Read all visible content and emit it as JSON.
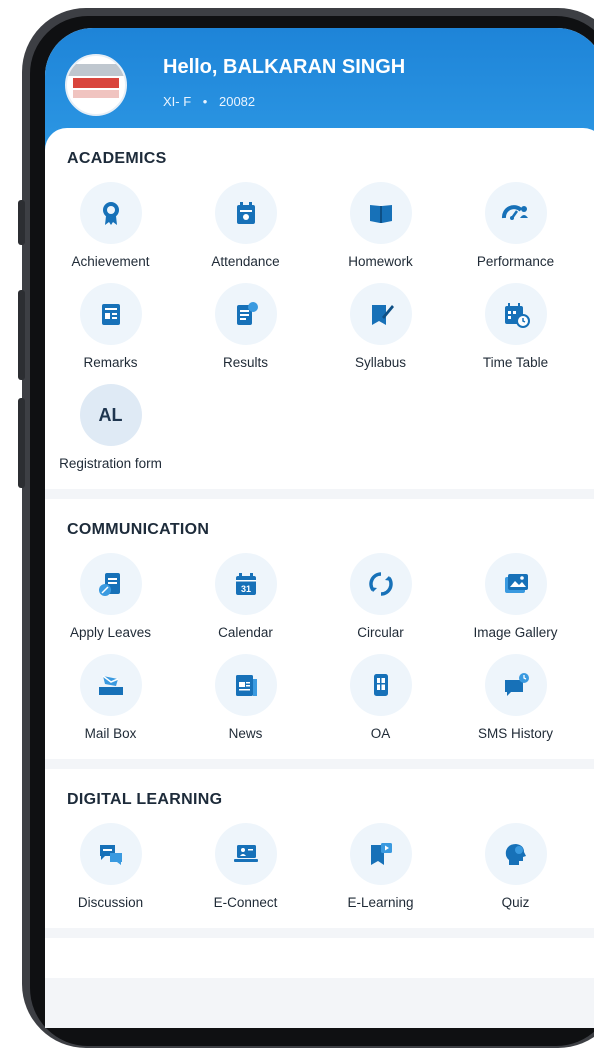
{
  "header": {
    "greeting": "Hello, BALKARAN SINGH",
    "class_section": "XI- F",
    "separator": "•",
    "admission_no": "20082"
  },
  "colors": {
    "header_blue": "#1e84d8",
    "icon_blue": "#1771b8",
    "icon_bg": "#eef5fb"
  },
  "academics": {
    "title": "ACADEMICS",
    "items": [
      {
        "label": "Achievement",
        "icon": "award-icon"
      },
      {
        "label": "Attendance",
        "icon": "attendance-icon"
      },
      {
        "label": "Homework",
        "icon": "book-icon"
      },
      {
        "label": "Performance",
        "icon": "performance-icon"
      },
      {
        "label": "Remarks",
        "icon": "remarks-icon"
      },
      {
        "label": "Results",
        "icon": "results-icon"
      },
      {
        "label": "Syllabus",
        "icon": "syllabus-icon"
      },
      {
        "label": "Time Table",
        "icon": "timetable-icon"
      },
      {
        "label": "Registration form",
        "initials": "AL"
      }
    ]
  },
  "communication": {
    "title": "COMMUNICATION",
    "items": [
      {
        "label": "Apply Leaves",
        "icon": "apply-leave-icon"
      },
      {
        "label": "Calendar",
        "icon": "calendar-icon",
        "day": "31"
      },
      {
        "label": "Circular",
        "icon": "circular-icon"
      },
      {
        "label": "Image Gallery",
        "icon": "image-gallery-icon"
      },
      {
        "label": "Mail Box",
        "icon": "mailbox-icon"
      },
      {
        "label": "News",
        "icon": "news-icon"
      },
      {
        "label": "OA",
        "icon": "oa-icon"
      },
      {
        "label": "SMS History",
        "icon": "sms-history-icon"
      }
    ]
  },
  "digital_learning": {
    "title": "DIGITAL LEARNING",
    "items": [
      {
        "label": "Discussion",
        "icon": "discussion-icon"
      },
      {
        "label": "E-Connect",
        "icon": "econnect-icon"
      },
      {
        "label": "E-Learning",
        "icon": "elearning-icon"
      },
      {
        "label": "Quiz",
        "icon": "quiz-icon"
      }
    ]
  }
}
